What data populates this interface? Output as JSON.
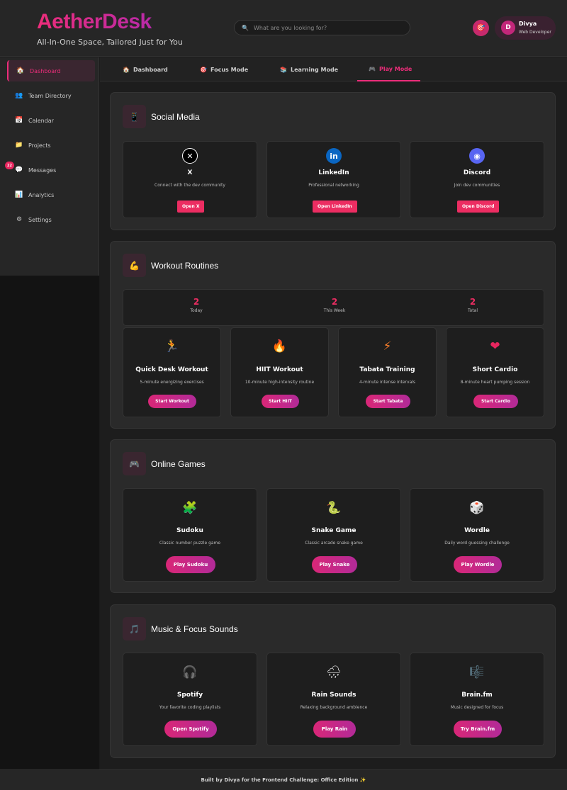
{
  "header": {
    "brand": "AetherDesk",
    "tagline": "All-In-One Space, Tailored Just for You",
    "search_placeholder": "What are you looking for?",
    "notif_icon": "🎯",
    "user": {
      "initial": "D",
      "name": "Divya",
      "role": "Web Developer"
    }
  },
  "sidebar": {
    "items": [
      {
        "icon": "🏠",
        "label": "Dashboard"
      },
      {
        "icon": "👥",
        "label": "Team Directory"
      },
      {
        "icon": "📅",
        "label": "Calendar"
      },
      {
        "icon": "📁",
        "label": "Projects"
      },
      {
        "icon": "💬",
        "label": "Messages",
        "badge": "22"
      },
      {
        "icon": "📊",
        "label": "Analytics"
      },
      {
        "icon": "⚙",
        "label": "Settings"
      }
    ]
  },
  "tabs": [
    {
      "icon": "🏠",
      "label": "Dashboard"
    },
    {
      "icon": "🎯",
      "label": "Focus Mode"
    },
    {
      "icon": "📚",
      "label": "Learning Mode"
    },
    {
      "icon": "🎮",
      "label": "Play Mode"
    }
  ],
  "social": {
    "icon": "📱",
    "title": "Social Media",
    "cards": [
      {
        "logo": "✕",
        "title": "X",
        "desc": "Connect with the dev community",
        "button": "Open X",
        "color": "#000000"
      },
      {
        "logo": "in",
        "title": "LinkedIn",
        "desc": "Professional networking",
        "button": "Open LinkedIn",
        "color": "#0a66c2"
      },
      {
        "logo": "◉",
        "title": "Discord",
        "desc": "Join dev communities",
        "button": "Open Discord",
        "color": "#5865f2"
      }
    ]
  },
  "workout": {
    "icon": "💪",
    "title": "Workout Routines",
    "stats": [
      {
        "value": "2",
        "label": "Today"
      },
      {
        "value": "2",
        "label": "This Week"
      },
      {
        "value": "2",
        "label": "Total"
      }
    ],
    "cards": [
      {
        "icon": "🏃",
        "title": "Quick Desk Workout",
        "desc": "5-minute energizing exercises",
        "button": "Start Workout"
      },
      {
        "icon": "🔥",
        "title": "HIIT Workout",
        "desc": "10-minute high-intensity routine",
        "button": "Start HIIT"
      },
      {
        "icon": "⚡",
        "title": "Tabata Training",
        "desc": "4-minute intense intervals",
        "button": "Start Tabata"
      },
      {
        "icon": "❤",
        "title": "Short Cardio",
        "desc": "8-minute heart pumping session",
        "button": "Start Cardio"
      }
    ]
  },
  "games": {
    "icon": "🎮",
    "title": "Online Games",
    "cards": [
      {
        "icon": "🧩",
        "title": "Sudoku",
        "desc": "Classic number puzzle game",
        "button": "Play Sudoku"
      },
      {
        "icon": "🐍",
        "title": "Snake Game",
        "desc": "Classic arcade snake game",
        "button": "Play Snake"
      },
      {
        "icon": "🎲",
        "title": "Wordle",
        "desc": "Daily word guessing challenge",
        "button": "Play Wordle"
      }
    ]
  },
  "music": {
    "icon": "🎵",
    "title": "Music & Focus Sounds",
    "cards": [
      {
        "icon": "🎧",
        "title": "Spotify",
        "desc": "Your favorite coding playlists",
        "button": "Open Spotify"
      },
      {
        "icon": "🌧",
        "title": "Rain Sounds",
        "desc": "Relaxing background ambience",
        "button": "Play Rain"
      },
      {
        "icon": "🎼",
        "title": "Brain.fm",
        "desc": "Music designed for focus",
        "button": "Try Brain.fm"
      }
    ]
  },
  "footer": {
    "text": "Built by Divya for the Frontend Challenge: Office Edition ✨"
  },
  "colors": {
    "accent": "#ec2d7a",
    "accent_button": "#ec2d62",
    "bg": "#1b1b1b",
    "panel": "#2a2a2a"
  }
}
